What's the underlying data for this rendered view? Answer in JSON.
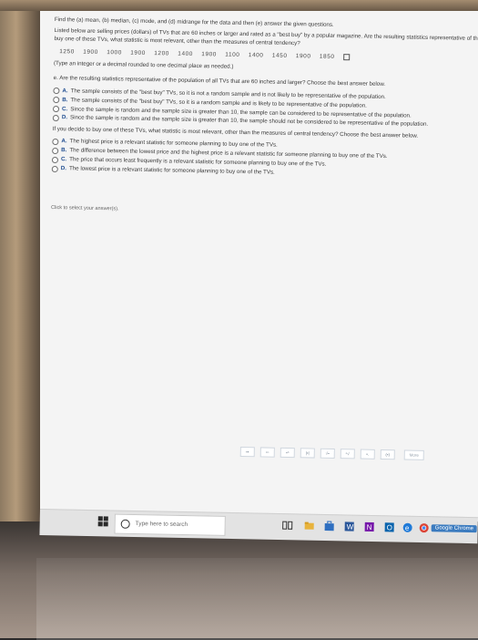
{
  "question": {
    "header": "Find the (a) mean, (b) median, (c) mode, and (d) midrange for the data and then (e) answer the given questions.",
    "intro_line1": "Listed below are selling prices (dollars) of TVs that are 60 inches or larger and rated as a \"best buy\" by a popular magazine. Are the resulting statistics representative of the popula",
    "intro_line2": "buy one of these TVs, what statistic is most relevant, other than the measures of central tendency?",
    "data_values": [
      "1250",
      "1900",
      "1000",
      "1900",
      "1200",
      "1400",
      "1900",
      "1100",
      "1400",
      "1450",
      "1900",
      "1850"
    ],
    "rounding_note": "(Type an integer or a decimal rounded to one decimal place as needed.)",
    "part_e_prompt": "e. Are the resulting statistics representative of the population of all TVs that are 60 inches and larger? Choose the best answer below.",
    "part_e_options": [
      {
        "letter": "A.",
        "text": "The sample consists of the \"best buy\" TVs, so it is not a random sample and is not likely to be representative of the population."
      },
      {
        "letter": "B.",
        "text": "The sample consists of the \"best buy\" TVs, so it is a random sample and is likely to be representative of the population."
      },
      {
        "letter": "C.",
        "text": "Since the sample is random and the sample size is greater than 10, the sample can be considered to be representative of the population."
      },
      {
        "letter": "D.",
        "text": "Since the sample is random and the sample size is greater than 10, the sample should not be considered to be representative of the population."
      }
    ],
    "followup_prompt": "If you decide to buy one of these TVs, what statistic is most relevant, other than the measures of central tendency? Choose the best answer below.",
    "followup_options": [
      {
        "letter": "A.",
        "text": "The highest price is a relevant statistic for someone planning to buy one of the TVs."
      },
      {
        "letter": "B.",
        "text": "The difference between the lowest price and the highest price is a relevant statistic for someone planning to buy one of the TVs."
      },
      {
        "letter": "C.",
        "text": "The price that occurs least frequently is a relevant statistic for someone planning to buy one of the TVs."
      },
      {
        "letter": "D.",
        "text": "The lowest price is a relevant statistic for someone planning to buy one of the TVs."
      }
    ],
    "click_hint": "Click to select your answer(s)."
  },
  "toolbar": {
    "more_label": "More"
  },
  "taskbar": {
    "search_placeholder": "Type here to search",
    "chrome_label": "Google Chrome"
  },
  "colors": {
    "option_letter": "#1d4b8f",
    "screen_bg": "#f4f4f4",
    "taskbar_bg": "#e3e3e3"
  }
}
